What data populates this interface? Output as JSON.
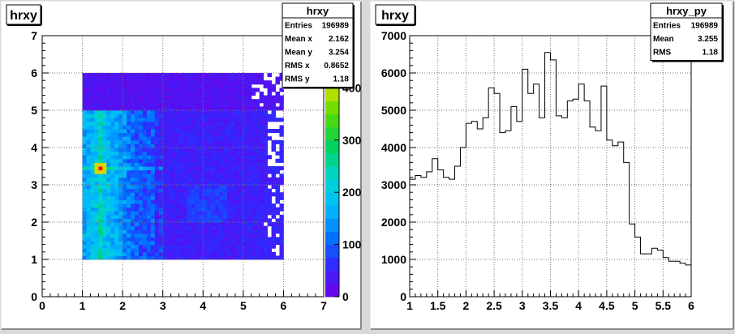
{
  "canvas": {
    "background": "#d9d9d9",
    "pad_color": "#ffffff"
  },
  "left_pad": {
    "title": "hrxy",
    "stats": {
      "title": "hrxy",
      "rows": [
        {
          "label": "Entries",
          "value": "196989"
        },
        {
          "label": "Mean x",
          "value": "2.162"
        },
        {
          "label": "Mean y",
          "value": "3.254"
        },
        {
          "label": "RMS x",
          "value": "0.8652"
        },
        {
          "label": "RMS y",
          "value": "1.18"
        }
      ]
    }
  },
  "right_pad": {
    "title": "hrxy",
    "stats": {
      "title": "hrxy_py",
      "rows": [
        {
          "label": "Entries",
          "value": "196989"
        },
        {
          "label": "Mean",
          "value": "3.255"
        },
        {
          "label": "RMS",
          "value": "1.18"
        }
      ]
    }
  },
  "chart_data": [
    {
      "type": "heatmap",
      "title": "hrxy",
      "xlim": [
        0,
        7
      ],
      "ylim": [
        0,
        7
      ],
      "x_ticks": [
        "0",
        "1",
        "2",
        "3",
        "4",
        "5",
        "6",
        "7"
      ],
      "y_ticks": [
        "0",
        "1",
        "2",
        "3",
        "4",
        "5",
        "6",
        "7"
      ],
      "filled_region": {
        "x": [
          1,
          6
        ],
        "y": [
          1,
          6
        ]
      },
      "bin_width": 0.1,
      "z_range": [
        0,
        500
      ],
      "colorbar_ticks": [
        "0",
        "100",
        "200",
        "300",
        "400"
      ],
      "peak": {
        "x": 1.45,
        "y": 3.45
      },
      "grid": true
    },
    {
      "type": "line",
      "style": "step",
      "title": "hrxy_py",
      "xlim": [
        1,
        6
      ],
      "ylim": [
        0,
        7000
      ],
      "x_ticks": [
        "1",
        "1.5",
        "2",
        "2.5",
        "3",
        "3.5",
        "4",
        "4.5",
        "5",
        "5.5",
        "6"
      ],
      "y_ticks": [
        "0",
        "1000",
        "2000",
        "3000",
        "4000",
        "5000",
        "6000",
        "7000"
      ],
      "bin_edges_start": 1.0,
      "bin_width": 0.1,
      "values": [
        3150,
        3250,
        3200,
        3350,
        3700,
        3400,
        3200,
        3150,
        3500,
        4000,
        4650,
        4700,
        4500,
        4800,
        5600,
        5450,
        4400,
        4450,
        5100,
        4700,
        6100,
        5450,
        5700,
        4800,
        6550,
        6350,
        4850,
        4800,
        5250,
        5300,
        5700,
        5250,
        4550,
        4450,
        5650,
        4200,
        4050,
        4150,
        3600,
        1950,
        1600,
        1150,
        1150,
        1300,
        1250,
        1050,
        950,
        950,
        900,
        850
      ],
      "grid": true
    }
  ]
}
